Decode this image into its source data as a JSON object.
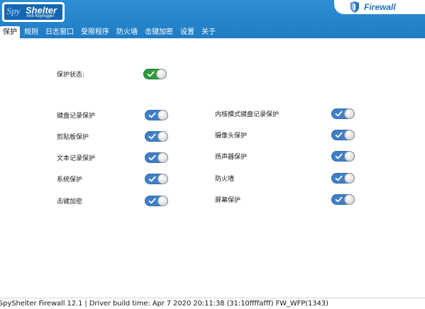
{
  "app": {
    "logo_spy": "Spy",
    "logo_shelter": "Shelter",
    "logo_sub": "Anti-Keylogger",
    "badge": "Firewall"
  },
  "tabs": [
    {
      "label": "保护",
      "active": true
    },
    {
      "label": "规则",
      "active": false
    },
    {
      "label": "日志窗口",
      "active": false
    },
    {
      "label": "受限程序",
      "active": false
    },
    {
      "label": "防火墙",
      "active": false
    },
    {
      "label": "击键加密",
      "active": false
    },
    {
      "label": "设置",
      "active": false
    },
    {
      "label": "关于",
      "active": false
    }
  ],
  "protection": {
    "status_label": "保护状态:",
    "status_on": true,
    "left_items": [
      {
        "label": "键盘记录保护",
        "on": true
      },
      {
        "label": "剪贴板保护",
        "on": true
      },
      {
        "label": "文本记录保护",
        "on": true
      },
      {
        "label": "系统保护",
        "on": true
      },
      {
        "label": "击键加密",
        "on": true
      }
    ],
    "right_items": [
      {
        "label": "内核模式键盘记录保护",
        "on": true
      },
      {
        "label": "摄像头保护",
        "on": true
      },
      {
        "label": "扬声器保护",
        "on": true
      },
      {
        "label": "防火墙",
        "on": true
      },
      {
        "label": "屏幕保护",
        "on": true
      }
    ]
  },
  "status_bar": {
    "text": "SpyShelter Firewall 12.1  |  Driver build time: Apr  7 2020 20:11:38  (31:10ffffafff) FW_WFP(1343)"
  },
  "colors": {
    "header": "#2e8fd3",
    "toggle_on": "#3f7fc8",
    "status_toggle_on": "#2d9b3e"
  }
}
